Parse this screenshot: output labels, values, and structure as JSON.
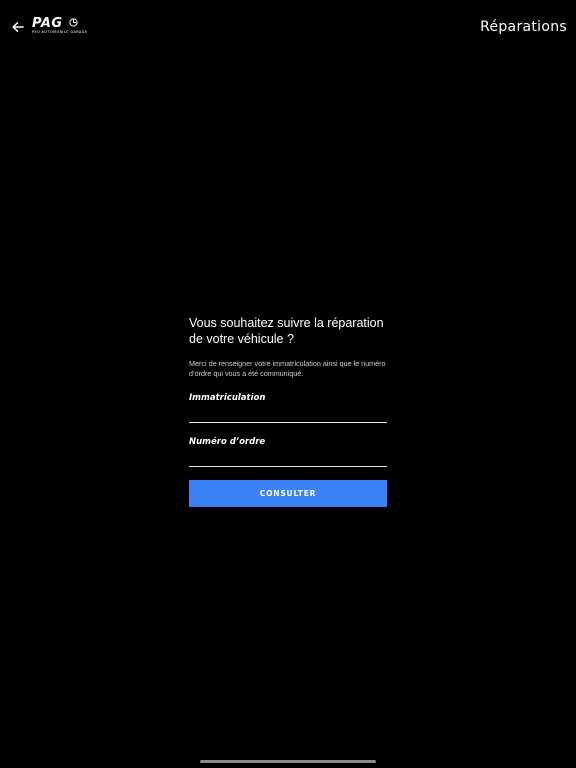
{
  "header": {
    "back_icon": "arrow-left-icon",
    "logo": {
      "text": "PAG",
      "subtitle": "PEU AUTOMOBILE GARAGE"
    },
    "title": "Réparations"
  },
  "form": {
    "heading": "Vous souhaitez suivre la réparation de votre véhicule ?",
    "description": "Merci de renseigner votre immatriculation ainsi que le numéro d’ordre qui vous a été communiqué.",
    "fields": [
      {
        "label": "Immatriculation",
        "value": "",
        "placeholder": ""
      },
      {
        "label": "Numéro d’ordre",
        "value": "",
        "placeholder": ""
      }
    ],
    "submit_label": "CONSULTER"
  },
  "colors": {
    "background": "#000000",
    "text": "#ffffff",
    "accent": "#3b82f6",
    "underline": "#e6e6e6"
  }
}
